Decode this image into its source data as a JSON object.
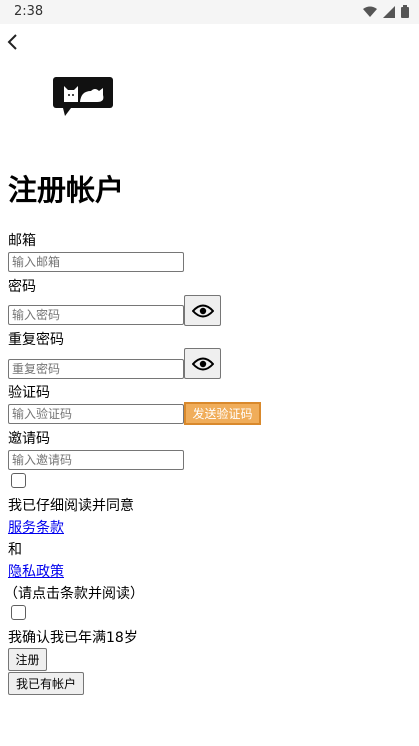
{
  "status_bar": {
    "time": "2:38"
  },
  "page": {
    "title": "注册帐户"
  },
  "form": {
    "email": {
      "label": "邮箱",
      "placeholder": "输入邮箱"
    },
    "password": {
      "label": "密码",
      "placeholder": "输入密码"
    },
    "repeat_password": {
      "label": "重复密码",
      "placeholder": "重复密码"
    },
    "code": {
      "label": "验证码",
      "placeholder": "输入验证码",
      "send_label": "发送验证码"
    },
    "invite": {
      "label": "邀请码",
      "placeholder": "输入邀请码"
    }
  },
  "agreement": {
    "read_text": "我已仔细阅读并同意",
    "terms_link": "服务条款",
    "and_text": "和",
    "privacy_link": "隐私政策",
    "hint_text": "（请点击条款并阅读）"
  },
  "age": {
    "text": "我确认我已年满18岁"
  },
  "actions": {
    "register_label": "注册",
    "have_account_label": "我已有帐户"
  },
  "colors": {
    "send_button": "#f0ad5a",
    "link": "#0000ee"
  }
}
